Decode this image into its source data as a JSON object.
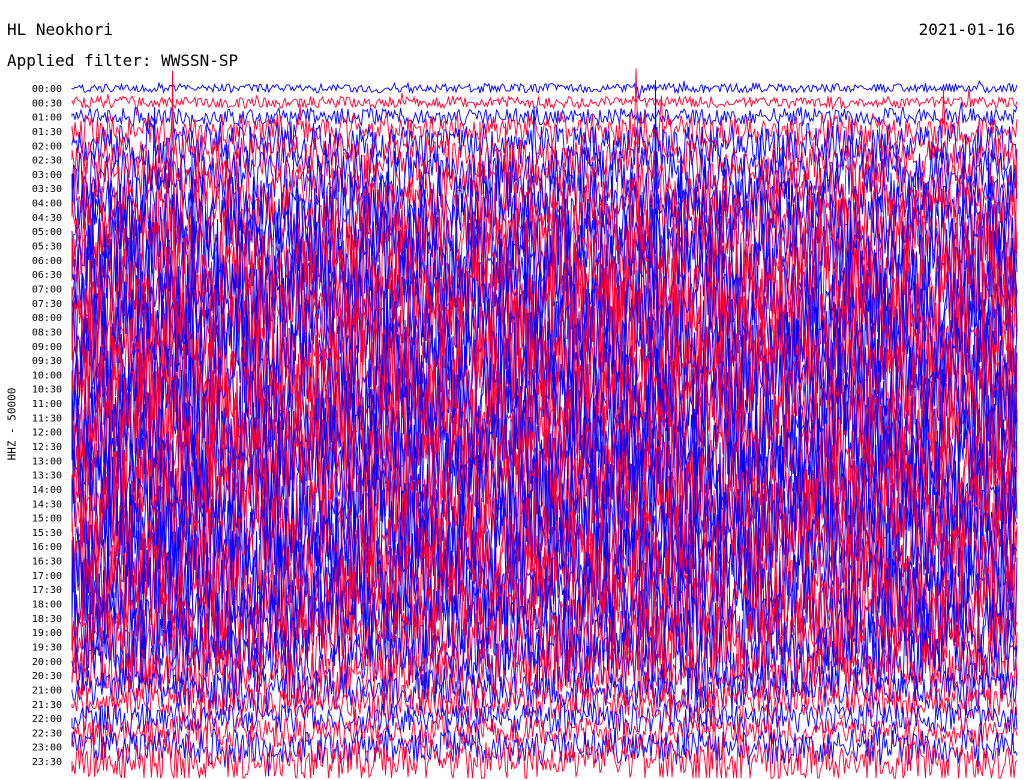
{
  "header": {
    "station": "HL Neokhori",
    "date": "2021-01-16",
    "filter": "Applied filter: WWSSN-SP"
  },
  "channel_label": "HHZ - 50000",
  "colors": {
    "trace_a": "#0000ff",
    "trace_b": "#ff0033",
    "background": "#ffffff"
  },
  "chart_data": {
    "type": "line",
    "title": "HL Neokhori",
    "ylabel": "HHZ - 50000",
    "row_labels": [
      "00:00",
      "00:30",
      "01:00",
      "01:30",
      "02:00",
      "02:30",
      "03:00",
      "03:30",
      "04:00",
      "04:30",
      "05:00",
      "05:30",
      "06:00",
      "06:30",
      "07:00",
      "07:30",
      "08:00",
      "08:30",
      "09:00",
      "09:30",
      "10:00",
      "10:30",
      "11:00",
      "11:30",
      "12:00",
      "12:30",
      "13:00",
      "13:30",
      "14:00",
      "14:30",
      "15:00",
      "15:30",
      "16:00",
      "16:30",
      "17:00",
      "17:30",
      "18:00",
      "18:30",
      "19:00",
      "19:30",
      "20:00",
      "20:30",
      "21:00",
      "21:30",
      "22:00",
      "22:30",
      "23:00",
      "23:30"
    ],
    "row_colors": [
      "blue",
      "red"
    ],
    "relative_amplitude": [
      0.25,
      0.35,
      0.5,
      0.9,
      1.2,
      1.3,
      1.5,
      1.7,
      1.9,
      2.1,
      2.4,
      2.6,
      2.8,
      3.0,
      3.0,
      3.1,
      3.1,
      3.2,
      3.2,
      3.2,
      3.2,
      3.2,
      3.2,
      3.2,
      3.2,
      3.2,
      3.2,
      3.2,
      3.2,
      3.2,
      3.2,
      3.1,
      3.1,
      3.0,
      3.0,
      2.9,
      2.8,
      2.6,
      2.4,
      2.1,
      1.9,
      1.6,
      1.2,
      1.0,
      0.9,
      0.9,
      1.0,
      1.2
    ],
    "grid": false
  }
}
